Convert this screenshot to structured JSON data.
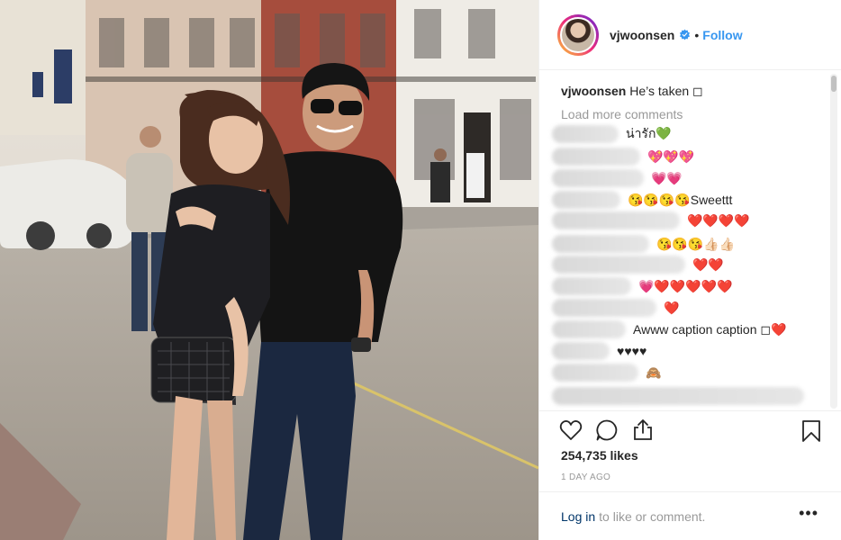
{
  "post": {
    "username": "vjwoonsen",
    "follow_label": "Follow",
    "header_separator": "•",
    "caption_user": "vjwoonsen",
    "caption_text": "He’s taken ◻",
    "load_more": "Load more comments",
    "likes": "254,735 likes",
    "time": "1 DAY AGO",
    "login_link": "Log in",
    "login_rest": "to like or comment.",
    "more_options": "•••"
  },
  "comments": [
    {
      "text": "น่ารัก💚"
    },
    {
      "text": "💖💖💖"
    },
    {
      "text": "💗💗"
    },
    {
      "text": "😘😘😘😘Sweettt"
    },
    {
      "text": "❤️❤️❤️❤️"
    },
    {
      "text": "😘😘😘👍🏻👍🏻"
    },
    {
      "text": "❤️❤️"
    },
    {
      "text": "💗❤️❤️❤️❤️❤️"
    },
    {
      "text": "❤️"
    },
    {
      "text": "Awww caption caption ◻❤️"
    },
    {
      "text": "♥♥♥♥"
    },
    {
      "text": "🙈"
    },
    {
      "text": ""
    }
  ],
  "colors": {
    "follow": "#3897f0",
    "login": "#003569",
    "muted": "#999999",
    "verified": "#3897f0"
  },
  "icons": [
    "verified-badge-icon",
    "heart-icon",
    "comment-icon",
    "share-icon",
    "bookmark-icon",
    "more-options-icon"
  ]
}
